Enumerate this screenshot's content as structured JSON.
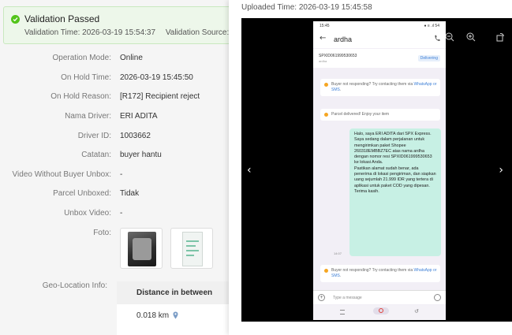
{
  "validation": {
    "title": "Validation Passed",
    "time_label": "Validation Time: 2026-03-19 15:54:37",
    "source_label": "Validation Source: Syst"
  },
  "fields": [
    {
      "label": "Operation Mode:",
      "value": "Online"
    },
    {
      "label": "On Hold Time:",
      "value": "2026-03-19 15:45:50"
    },
    {
      "label": "On Hold Reason:",
      "value": "[R172] Recipient reject"
    },
    {
      "label": "Nama Driver:",
      "value": "ERI ADITA"
    },
    {
      "label": "Driver ID:",
      "value": "1003662"
    },
    {
      "label": "Catatan:",
      "value": "buyer hantu"
    },
    {
      "label": "Video Without Buyer Unbox:",
      "value": "-"
    },
    {
      "label": "Parcel Unboxed:",
      "value": "Tidak"
    },
    {
      "label": "Unbox Video:",
      "value": "-"
    },
    {
      "label": "Foto:",
      "value": ""
    },
    {
      "label": "Geo-Location Info:",
      "value": ""
    }
  ],
  "geo": {
    "header": "Distance in between",
    "distance": "0.018 km"
  },
  "viewer": {
    "uploaded": "Uploaded Time: 2026-03-19 15:45:58"
  },
  "phone": {
    "status_time": "15:45",
    "status_right": "● ≡ .ıl 54",
    "contact_name": "ardha",
    "tracking_id": "SPXID061999530653",
    "tracking_sub": "ardha",
    "status_badge": "Delivering",
    "sys_msg_1_text": "Buyer not responding? Try contacting them via ",
    "sys_msg_link": "WhatsApp or SMS",
    "sys_msg_2_text": "Parcel delivered! Enjoy your item",
    "bubble_text": "Halo, saya ERI ADITA  dari SPX Express. Saya sedang dalam perjalanan untuk mengirimkan paket Shopee 260318EMBBZ7EC atas nama ardha  dengan nomor resi SPXID061999530653  ke lokasi Anda.\nPastikan alamat sudah benar, ada penerima di lokasi pengiriman, dan siapkan uang sejumlah 21.999 IDR  yang tertera di aplikasi untuk paket COD yang dipesan.\n Terima kasih.",
    "bubble_time": "14:07",
    "composer_placeholder": "Type a message"
  },
  "colors": {
    "success": "#52c41a",
    "link": "#3d7fd6",
    "bubble": "#c7f0e4"
  }
}
